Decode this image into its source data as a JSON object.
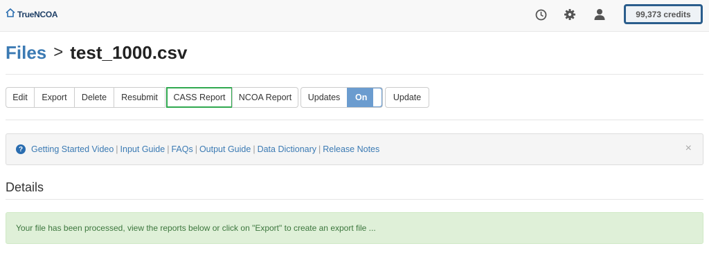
{
  "navbar": {
    "brand": "TrueNCOA",
    "credits": "99,373 credits",
    "icons": [
      "clock-icon",
      "gear-icon",
      "user-icon"
    ]
  },
  "breadcrumb": {
    "parent": "Files",
    "separator": ">",
    "current": "test_1000.csv"
  },
  "toolbar": {
    "edit": "Edit",
    "export": "Export",
    "delete": "Delete",
    "resubmit": "Resubmit",
    "cass_report": "CASS Report",
    "ncoa_report": "NCOA Report",
    "updates": "Updates",
    "toggle_state": "On",
    "update": "Update"
  },
  "info_links": {
    "getting_started": "Getting Started Video",
    "input_guide": "Input Guide",
    "faqs": "FAQs",
    "output_guide": "Output Guide",
    "data_dictionary": "Data Dictionary",
    "release_notes": "Release Notes",
    "separator": "|",
    "close": "×"
  },
  "details": {
    "heading": "Details",
    "message": "Your file has been processed, view the reports below or click on \"Export\" to create an export file ..."
  },
  "colors": {
    "brand_blue": "#3b7ab3",
    "credits_border": "#2a5d8c",
    "highlight_green": "#2fa84f",
    "toggle_blue": "#6b9ccf",
    "alert_bg": "#dff0d8"
  }
}
